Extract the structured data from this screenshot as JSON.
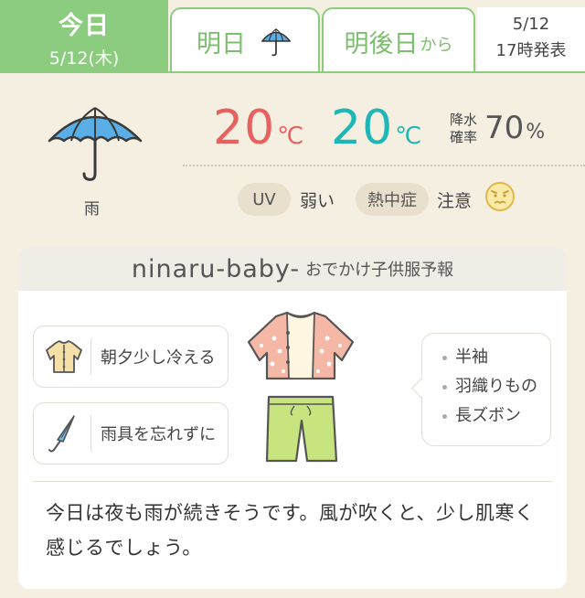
{
  "tabs": {
    "today": {
      "label": "今日",
      "date": "5/12(木)"
    },
    "tomorrow": {
      "label": "明日",
      "icon": "umbrella-icon"
    },
    "day_after": {
      "label": "明後日",
      "suffix": "から"
    },
    "announce": {
      "date": "5/12",
      "time": "17時発表"
    }
  },
  "weather": {
    "icon": "umbrella-icon",
    "label": "雨",
    "temp_high": "20",
    "temp_low": "20",
    "temp_unit": "℃",
    "rain_label_1": "降水",
    "rain_label_2": "確率",
    "rain_value": "70",
    "rain_unit": "%",
    "uv_label": "UV",
    "uv_value": "弱い",
    "heat_label": "熱中症",
    "heat_value": "注意",
    "heat_icon": "worried-face-icon"
  },
  "card": {
    "brand": "ninaru-baby-",
    "brand_sub": "おでかけ子供服予報",
    "tips": [
      {
        "icon": "cardigan-icon",
        "text": "朝夕少し冷える"
      },
      {
        "icon": "umbrella-closed-icon",
        "text": "雨具を忘れずに"
      }
    ],
    "clothes_icon": "cardigan-and-pants-icon",
    "recommend": [
      "半袖",
      "羽織りもの",
      "長ズボン"
    ],
    "comment": "今日は夜も雨が続きそうです。風が吹くと、少し肌寒く感じるでしょう。"
  },
  "colors": {
    "accent_green": "#8bcc7e",
    "temp_high": "#e86060",
    "temp_low": "#1fb7b5",
    "umbrella_blue": "#5aaee6"
  }
}
